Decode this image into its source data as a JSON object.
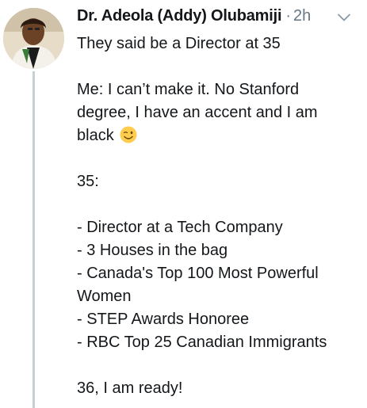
{
  "author": {
    "name": "Dr. Adeola (Addy) Olubamiji",
    "separator": "·",
    "time": "2h"
  },
  "icons": {
    "avatar": "profile-photo",
    "menu": "chevron-down-icon",
    "emoji": "winking-face-emoji"
  },
  "colors": {
    "text": "#14171a",
    "muted": "#657786",
    "thread_line": "#c4cfd6"
  },
  "tweet": {
    "line1": "They said be a Director at 35",
    "line2": "Me: I can’t make it. No Stanford",
    "line3": "degree, I have an accent and I am",
    "line4": "black",
    "line5": "35:",
    "line6": "- Director at a Tech Company",
    "line7": "- 3 Houses in the bag",
    "line8": "- Canada's Top 100 Most Powerful",
    "line9": "Women",
    "line10": "- STEP Awards Honoree",
    "line11": "- RBC Top 25 Canadian Immigrants",
    "line12": "36, I am ready!"
  }
}
